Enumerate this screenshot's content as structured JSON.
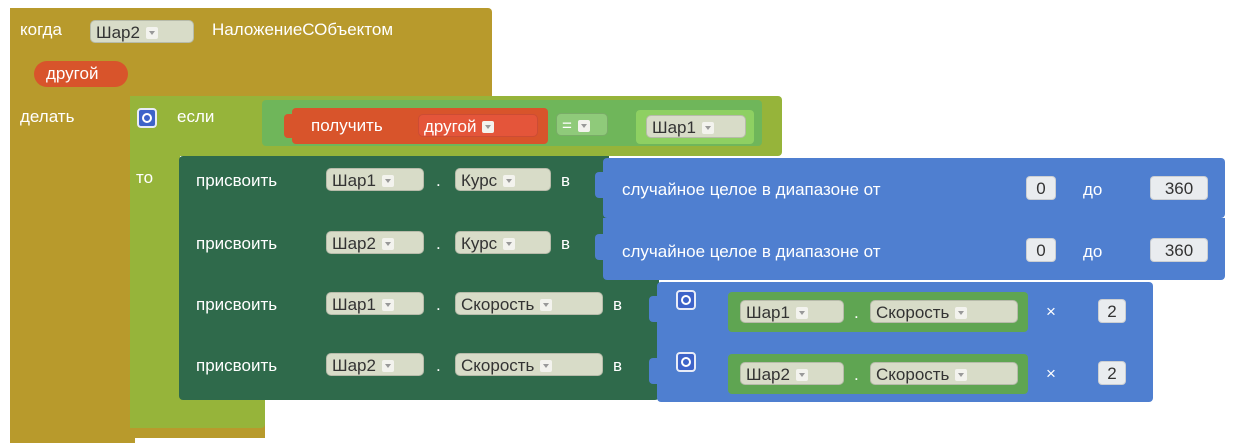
{
  "event": {
    "when_label": "когда",
    "component": "Шар2",
    "event_name": "НаложениеСОбъектом",
    "param": "другой",
    "do_label": "делать"
  },
  "if_block": {
    "if_label": "если",
    "then_label": "то",
    "get_label": "получить",
    "get_var": "другой",
    "eq_op": "=",
    "compare_to": "Шар1"
  },
  "statements": [
    {
      "set_label": "присвоить",
      "component": "Шар1",
      "property": "Курс",
      "to_label": "в",
      "random_label": "случайное целое в диапазоне от",
      "from": "0",
      "to_word": "до",
      "to": "360"
    },
    {
      "set_label": "присвоить",
      "component": "Шар2",
      "property": "Курс",
      "to_label": "в",
      "random_label": "случайное целое в диапазоне от",
      "from": "0",
      "to_word": "до",
      "to": "360"
    },
    {
      "set_label": "присвоить",
      "component": "Шар1",
      "property": "Скорость",
      "to_label": "в",
      "get_component": "Шар1",
      "get_property": "Скорость",
      "op": "×",
      "factor": "2"
    },
    {
      "set_label": "присвоить",
      "component": "Шар2",
      "property": "Скорость",
      "to_label": "в",
      "get_component": "Шар2",
      "get_property": "Скорость",
      "op": "×",
      "factor": "2"
    }
  ],
  "colors": {
    "event": "#b89a2c",
    "control": "#96b43a",
    "variable": "#d8542b",
    "setter": "#2f6a4b",
    "math": "#4f7fd0",
    "getter": "#5fa552"
  }
}
